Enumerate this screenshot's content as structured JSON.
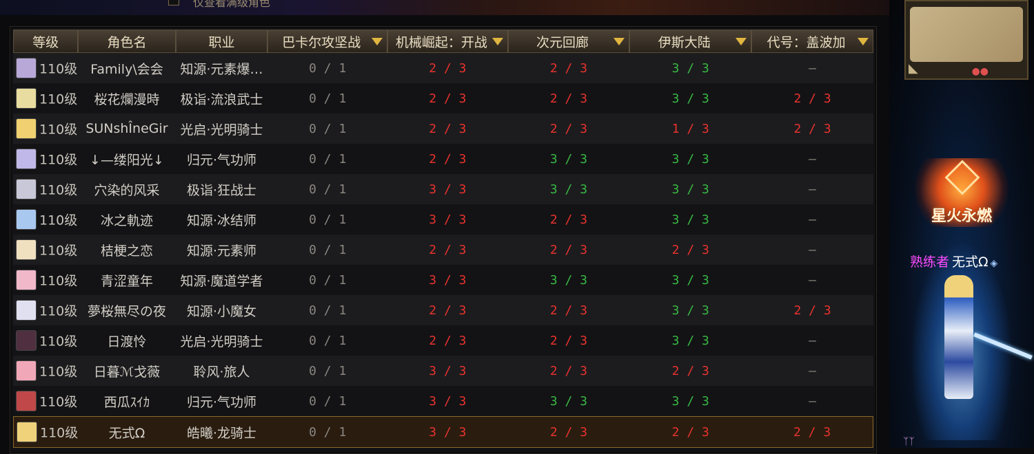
{
  "top": {
    "checkbox_label": "仅查看满级角色"
  },
  "table": {
    "headers": [
      {
        "label": "等级",
        "dropdown": false
      },
      {
        "label": "角色名",
        "dropdown": false
      },
      {
        "label": "职业",
        "dropdown": false
      },
      {
        "label": "巴卡尔攻坚战",
        "dropdown": true
      },
      {
        "label": "机械崛起：开战",
        "dropdown": true
      },
      {
        "label": "次元回廊",
        "dropdown": true
      },
      {
        "label": "伊斯大陆",
        "dropdown": true
      },
      {
        "label": "代号：盖波加",
        "dropdown": true
      }
    ],
    "rows": [
      {
        "level": "110级",
        "name": "Family\\会会",
        "job": "知源·元素爆…",
        "bakal": "0 / 1",
        "mech": "2 / 3",
        "dim": "2 / 3",
        "isle": "3 / 3",
        "gaboga": "—",
        "colors": [
          "gray",
          "red",
          "red",
          "green",
          "dash"
        ],
        "avatar": "#b8a8d8"
      },
      {
        "level": "110级",
        "name": "桜花爛漫時",
        "job": "极诣·流浪武士",
        "bakal": "0 / 1",
        "mech": "2 / 3",
        "dim": "2 / 3",
        "isle": "3 / 3",
        "gaboga": "2 / 3",
        "colors": [
          "gray",
          "red",
          "red",
          "green",
          "red"
        ],
        "avatar": "#e8dca0"
      },
      {
        "level": "110级",
        "name": "SUNshÎneGir",
        "job": "光启·光明骑士",
        "bakal": "0 / 1",
        "mech": "2 / 3",
        "dim": "2 / 3",
        "isle": "1 / 3",
        "gaboga": "2 / 3",
        "colors": [
          "gray",
          "red",
          "red",
          "red",
          "red"
        ],
        "avatar": "#f0d070"
      },
      {
        "level": "110级",
        "name": "↓—缕阳光↓",
        "job": "归元·气功师",
        "bakal": "0 / 1",
        "mech": "2 / 3",
        "dim": "3 / 3",
        "isle": "3 / 3",
        "gaboga": "—",
        "colors": [
          "gray",
          "red",
          "green",
          "green",
          "dash"
        ],
        "avatar": "#c0b8e8"
      },
      {
        "level": "110级",
        "name": "穴染的风采",
        "job": "极诣·狂战士",
        "bakal": "0 / 1",
        "mech": "3 / 3",
        "dim": "3 / 3",
        "isle": "3 / 3",
        "gaboga": "—",
        "colors": [
          "gray",
          "red",
          "green",
          "green",
          "dash"
        ],
        "avatar": "#c8c8d8"
      },
      {
        "level": "110级",
        "name": "冰之軌迹",
        "job": "知源·冰结师",
        "bakal": "0 / 1",
        "mech": "3 / 3",
        "dim": "2 / 3",
        "isle": "3 / 3",
        "gaboga": "—",
        "colors": [
          "gray",
          "red",
          "red",
          "green",
          "dash"
        ],
        "avatar": "#a8c8f0"
      },
      {
        "level": "110级",
        "name": "桔梗之恋",
        "job": "知源·元素师",
        "bakal": "0 / 1",
        "mech": "2 / 3",
        "dim": "2 / 3",
        "isle": "2 / 3",
        "gaboga": "—",
        "colors": [
          "gray",
          "red",
          "red",
          "red",
          "dash"
        ],
        "avatar": "#f0e0c0"
      },
      {
        "level": "110级",
        "name": "青涩童年",
        "job": "知源·魔道学者",
        "bakal": "0 / 1",
        "mech": "3 / 3",
        "dim": "3 / 3",
        "isle": "3 / 3",
        "gaboga": "—",
        "colors": [
          "gray",
          "red",
          "green",
          "green",
          "dash"
        ],
        "avatar": "#f0b8c8"
      },
      {
        "level": "110级",
        "name": "夢桜無尽の夜",
        "job": "知源·小魔女",
        "bakal": "0 / 1",
        "mech": "2 / 3",
        "dim": "2 / 3",
        "isle": "3 / 3",
        "gaboga": "2 / 3",
        "colors": [
          "gray",
          "red",
          "red",
          "green",
          "red"
        ],
        "avatar": "#e0e0f0"
      },
      {
        "level": "110级",
        "name": "日渡怜",
        "job": "光启·光明骑士",
        "bakal": "0 / 1",
        "mech": "2 / 3",
        "dim": "2 / 3",
        "isle": "3 / 3",
        "gaboga": "—",
        "colors": [
          "gray",
          "red",
          "red",
          "green",
          "dash"
        ],
        "avatar": "#503040"
      },
      {
        "level": "110级",
        "name": "日暮ℳ戈薇",
        "job": "聆风·旅人",
        "bakal": "0 / 1",
        "mech": "3 / 3",
        "dim": "2 / 3",
        "isle": "2 / 3",
        "gaboga": "—",
        "colors": [
          "gray",
          "red",
          "red",
          "red",
          "dash"
        ],
        "avatar": "#f0a8b8"
      },
      {
        "level": "110级",
        "name": "西瓜ｽｲｶ",
        "job": "归元·气功师",
        "bakal": "0 / 1",
        "mech": "3 / 3",
        "dim": "3 / 3",
        "isle": "3 / 3",
        "gaboga": "—",
        "colors": [
          "gray",
          "red",
          "green",
          "green",
          "dash"
        ],
        "avatar": "#c04848"
      },
      {
        "level": "110级",
        "name": "无式Ω",
        "job": "皓曦·龙骑士",
        "bakal": "0 / 1",
        "mech": "3 / 3",
        "dim": "2 / 3",
        "isle": "2 / 3",
        "gaboga": "2 / 3",
        "colors": [
          "gray",
          "red",
          "red",
          "red",
          "red"
        ],
        "avatar": "#f0d27a",
        "selected": true
      }
    ]
  },
  "side": {
    "emblem_title": "星火永燃",
    "rank_title": "熟练者",
    "char_name": "无式Ω",
    "gem_icon": "◈"
  },
  "colors": {
    "red": "#e8322e",
    "green": "#38b844",
    "gray": "#8a8680",
    "header_text": "#e8dcc0",
    "dropdown_arrow": "#e0b640"
  }
}
